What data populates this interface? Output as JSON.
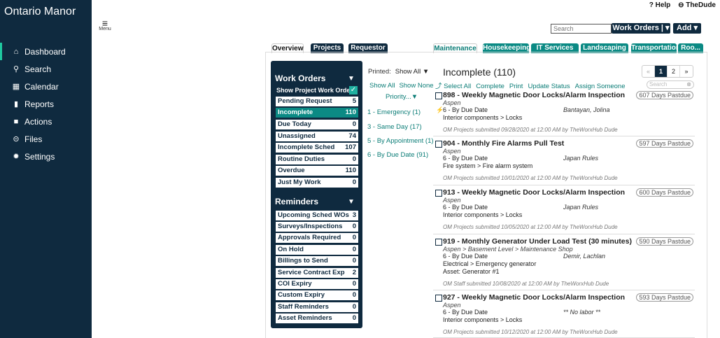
{
  "app": {
    "title": "Ontario Manor"
  },
  "topbar": {
    "help": "? Help",
    "user": "⊖ TheDude",
    "menu_label": "Menu",
    "search_placeholder": "Search",
    "workorders_btn": "Work Orders | ▾",
    "add_btn": "Add ▾"
  },
  "sidebar": {
    "items": [
      {
        "icon": "⌂",
        "label": "Dashboard"
      },
      {
        "icon": "⚲",
        "label": "Search"
      },
      {
        "icon": "▦",
        "label": "Calendar"
      },
      {
        "icon": "▮",
        "label": "Reports"
      },
      {
        "icon": "■",
        "label": "Actions"
      },
      {
        "icon": "⊝",
        "label": "Files"
      },
      {
        "icon": "✹",
        "label": "Settings"
      }
    ]
  },
  "left_tabs": [
    "Overview",
    "Projects",
    "Requestor"
  ],
  "right_tabs": [
    "Maintenance",
    "Housekeeping",
    "IT Services",
    "Landscaping",
    "Transportation",
    "Roo..."
  ],
  "workorders_panel": {
    "heading": "Work Orders",
    "show_project": "Show Project Work Orders",
    "rows": [
      {
        "label": "Pending Request",
        "count": "5"
      },
      {
        "label": "Incomplete",
        "count": "110"
      },
      {
        "label": "Due Today",
        "count": "0"
      },
      {
        "label": "Unassigned",
        "count": "74"
      },
      {
        "label": "Incomplete Sched",
        "count": "107"
      },
      {
        "label": "Routine Duties",
        "count": "0"
      },
      {
        "label": "Overdue",
        "count": "110"
      },
      {
        "label": "Just My Work",
        "count": "0"
      }
    ],
    "reminders_heading": "Reminders",
    "reminders": [
      {
        "label": "Upcoming Sched WOs",
        "count": "3"
      },
      {
        "label": "Surveys/Inspections",
        "count": "0"
      },
      {
        "label": "Approvals Required",
        "count": "0"
      },
      {
        "label": "On Hold",
        "count": "0"
      },
      {
        "label": "Billings to Send",
        "count": "0"
      },
      {
        "label": "Service Contract Exp",
        "count": "2"
      },
      {
        "label": "COI Expiry",
        "count": "0"
      },
      {
        "label": "Custom Expiry",
        "count": "0"
      },
      {
        "label": "Staff Reminders",
        "count": "0"
      },
      {
        "label": "Asset Reminders",
        "count": "0"
      }
    ]
  },
  "filters": {
    "printed_label": "Printed:",
    "printed_value": "Show All ▼",
    "show_all": "Show All",
    "show_none": "Show None",
    "priority_head": "Priority...▼",
    "priorities": [
      "1 - Emergency (1)",
      "3 - Same Day (17)",
      "5 - By Appointment (1)",
      "6 - By Due Date (91)"
    ]
  },
  "list": {
    "title": "Incomplete (110)",
    "pager": [
      "«",
      "1",
      "2",
      "»"
    ],
    "actions": [
      "⤴ Select All",
      "Complete",
      "Print",
      "Update Status",
      "Assign Someone"
    ],
    "filter_placeholder": "Search",
    "filter_clear": "⊗",
    "items": [
      {
        "title": "898 - Weekly Magnetic Door Locks/Alarm Inspection",
        "pastdue": "607 Days Pastdue",
        "loc": "Aspen",
        "priority": "6 - By Due Date",
        "assignee": "Bantayan, Jolina",
        "category": "Interior components > Locks",
        "asset": "",
        "submitted": "OM Projects submitted 09/28/2020 at 12:00 AM by TheWorxHub Dude",
        "bolt": true
      },
      {
        "title": "904 - Monthly Fire Alarms Pull Test",
        "pastdue": "597 Days Pastdue",
        "loc": "Aspen",
        "priority": "6 - By Due Date",
        "assignee": "Japan Rules",
        "category": "Fire system > Fire alarm system",
        "asset": "",
        "submitted": "OM Projects submitted 10/01/2020 at 12:00 AM by TheWorxHub Dude",
        "bolt": false
      },
      {
        "title": "913 - Weekly Magnetic Door Locks/Alarm Inspection",
        "pastdue": "600 Days Pastdue",
        "loc": "Aspen",
        "priority": "6 - By Due Date",
        "assignee": "Japan Rules",
        "category": "Interior components > Locks",
        "asset": "",
        "submitted": "OM Projects submitted 10/05/2020 at 12:00 AM by TheWorxHub Dude",
        "bolt": false
      },
      {
        "title": "919 - Monthly Generator Under Load Test (30 minutes)",
        "pastdue": "590 Days Pastdue",
        "loc": "Aspen > Basement Level > Maintenance Shop",
        "priority": "6 - By Due Date",
        "assignee": "Demir, Lachlan",
        "category": "Electrical > Emergency generator",
        "asset": "Asset: Generator #1",
        "submitted": "OM Staff submitted 10/08/2020 at 12:00 AM by TheWorxHub Dude",
        "bolt": false
      },
      {
        "title": "927 - Weekly Magnetic Door Locks/Alarm Inspection",
        "pastdue": "593 Days Pastdue",
        "loc": "Aspen",
        "priority": "6 - By Due Date",
        "assignee": "** No labor **",
        "category": "Interior components > Locks",
        "asset": "",
        "submitted": "OM Projects submitted 10/12/2020 at 12:00 AM by TheWorxHub Dude",
        "bolt": false
      }
    ]
  }
}
